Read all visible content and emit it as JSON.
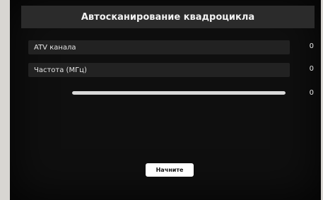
{
  "header": {
    "title": "Автосканирование квадроцикла"
  },
  "rows": [
    {
      "label": "ATV канала",
      "value": "0"
    },
    {
      "label": "Частота (МГц)",
      "value": "0"
    }
  ],
  "progress": {
    "value_text": "0",
    "fraction": 1.0
  },
  "actions": {
    "start_label": "Начните"
  }
}
